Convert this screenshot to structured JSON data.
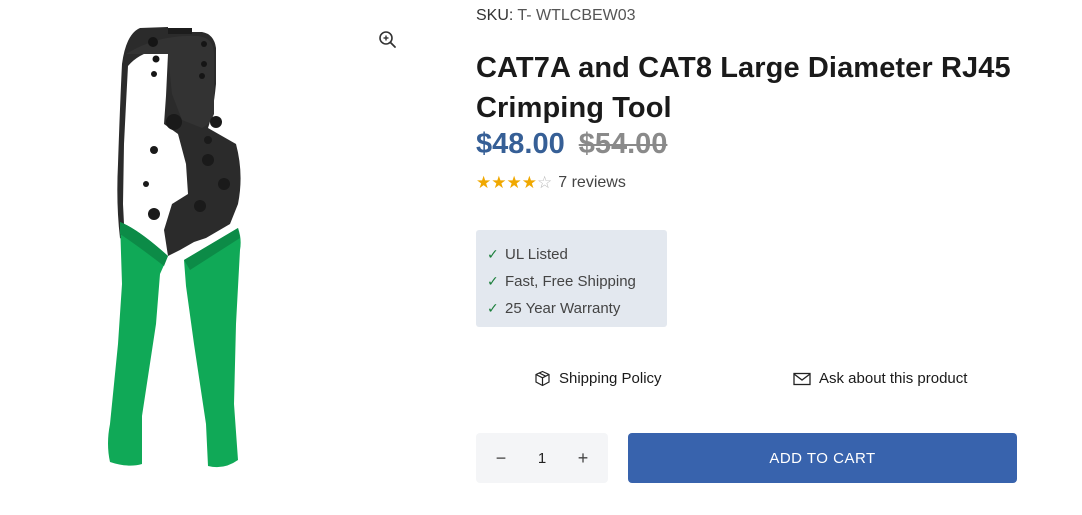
{
  "product": {
    "sku_label": "SKU:",
    "sku_value": "T- WTLCBEW03",
    "title": "CAT7A and CAT8 Large Diameter RJ45 Crimping Tool",
    "price_sale": "$48.00",
    "price_original": "$54.00",
    "rating": 4,
    "rating_max": 5,
    "reviews_text": "7 reviews"
  },
  "features": [
    {
      "icon": "check-icon",
      "check": "✓",
      "label": "UL Listed"
    },
    {
      "icon": "check-icon",
      "check": "✓",
      "label": "Fast, Free Shipping"
    },
    {
      "icon": "check-icon",
      "check": "✓",
      "label": "25 Year Warranty"
    }
  ],
  "links": {
    "shipping_label": "Shipping Policy",
    "shipping_icon": "box-icon",
    "ask_label": "Ask about this product",
    "ask_icon": "envelope-icon"
  },
  "cart": {
    "quantity": "1",
    "decrement": "−",
    "increment": "+",
    "add_label": "ADD TO CART"
  },
  "colors": {
    "price_sale": "#365f96",
    "accent_button": "#3863ad",
    "handle_green": "#10a957",
    "star": "#f0a800"
  },
  "image": {
    "zoom_icon": "zoom-in-icon",
    "product_image": "crimping-tool-photo"
  }
}
